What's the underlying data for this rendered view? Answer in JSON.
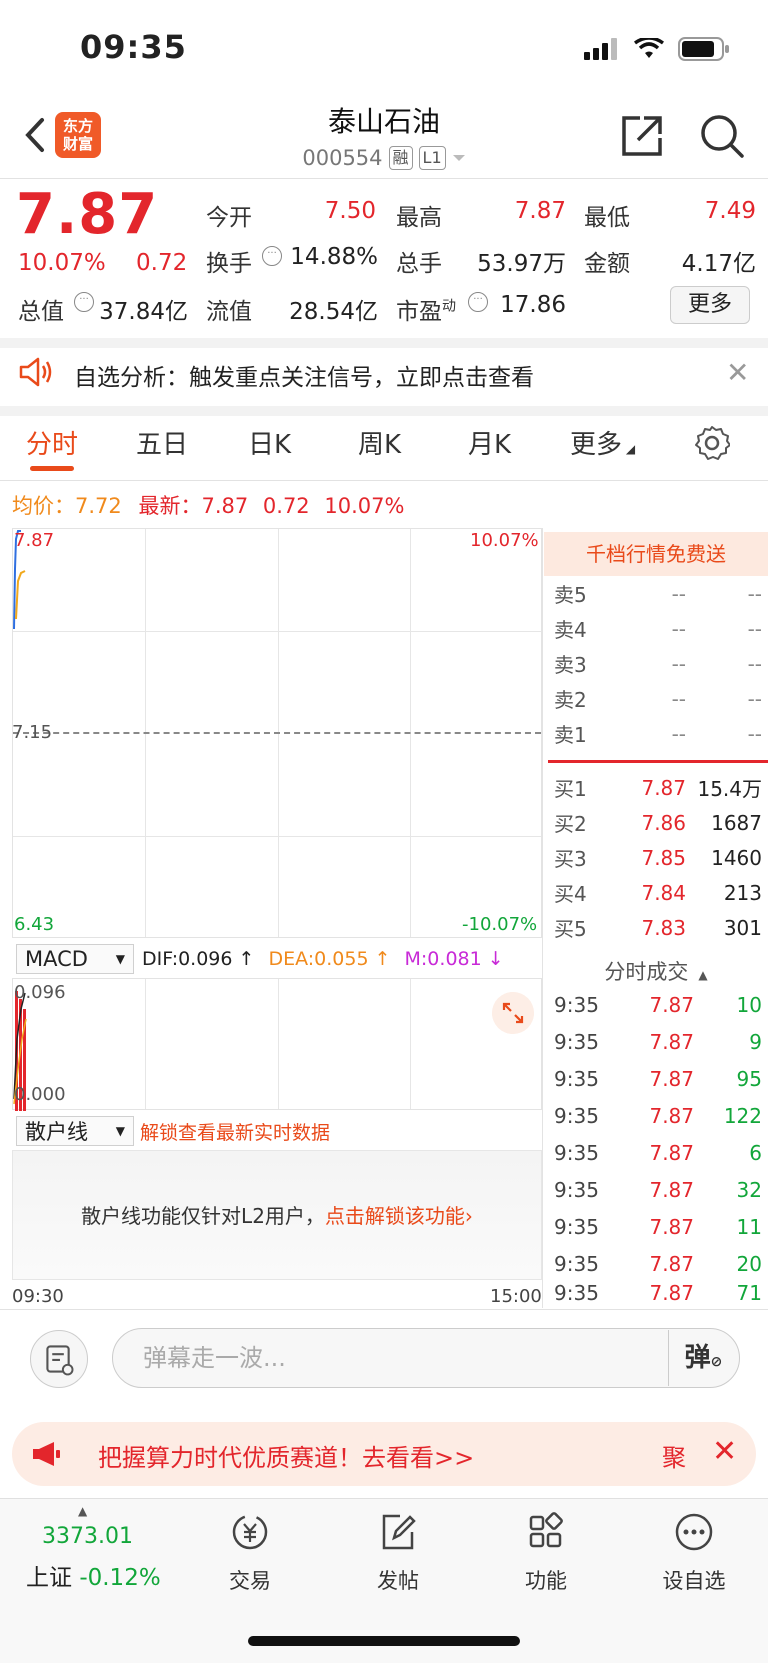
{
  "status": {
    "time": "09:35"
  },
  "header": {
    "logo_line1": "东方",
    "logo_line2": "财富",
    "stock_name": "泰山石油",
    "stock_code": "000554",
    "tag_margin": "融",
    "tag_level": "L1"
  },
  "quote": {
    "price": "7.87",
    "pct": "10.07%",
    "change": "0.72",
    "open_label": "今开",
    "open": "7.50",
    "high_label": "最高",
    "high": "7.87",
    "low_label": "最低",
    "low": "7.49",
    "turnover_label": "换手",
    "turnover": "14.88%",
    "volume_label": "总手",
    "volume": "53.97万",
    "amount_label": "金额",
    "amount": "4.17亿",
    "mcap_label": "总值",
    "mcap": "37.84亿",
    "float_label": "流值",
    "float": "28.54亿",
    "pe_label": "市盈",
    "pe_sup": "动",
    "pe": "17.86",
    "more": "更多"
  },
  "notice": {
    "text": "自选分析：触发重点关注信号，立即点击查看"
  },
  "tabs": [
    "分时",
    "五日",
    "日K",
    "周K",
    "月K",
    "更多"
  ],
  "chart_header": {
    "avg_label": "均价：",
    "avg": "7.72",
    "latest_label": "最新：",
    "latest": "7.87",
    "chg": "0.72",
    "pct": "10.07%"
  },
  "chart_data": {
    "type": "line",
    "ylim": [
      6.43,
      7.87
    ],
    "y_ticks": [
      "7.87",
      "7.15",
      "6.43"
    ],
    "pct_ticks": [
      "10.07%",
      "-10.07%"
    ],
    "x_ticks": [
      "09:30",
      "15:00"
    ],
    "baseline": 7.15
  },
  "macd": {
    "selector": "MACD",
    "dif": "DIF:0.096 ↑",
    "dea": "DEA:0.055 ↑",
    "m": "M:0.081 ↓",
    "top": "0.096",
    "bottom": "0.000"
  },
  "retail": {
    "selector": "散户线",
    "unlock_hint": "解锁查看最新实时数据",
    "desc": "散户线功能仅针对L2用户，",
    "link": "点击解锁该功能›"
  },
  "orderbook": {
    "banner": "千档行情免费送",
    "asks": [
      {
        "label": "卖5",
        "price": "--",
        "vol": "--"
      },
      {
        "label": "卖4",
        "price": "--",
        "vol": "--"
      },
      {
        "label": "卖3",
        "price": "--",
        "vol": "--"
      },
      {
        "label": "卖2",
        "price": "--",
        "vol": "--"
      },
      {
        "label": "卖1",
        "price": "--",
        "vol": "--"
      }
    ],
    "bids": [
      {
        "label": "买1",
        "price": "7.87",
        "vol": "15.4万"
      },
      {
        "label": "买2",
        "price": "7.86",
        "vol": "1687"
      },
      {
        "label": "买3",
        "price": "7.85",
        "vol": "1460"
      },
      {
        "label": "买4",
        "price": "7.84",
        "vol": "213"
      },
      {
        "label": "买5",
        "price": "7.83",
        "vol": "301"
      }
    ],
    "ticks_title": "分时成交",
    "ticks": [
      {
        "t": "9:35",
        "p": "7.87",
        "v": "10"
      },
      {
        "t": "9:35",
        "p": "7.87",
        "v": "9"
      },
      {
        "t": "9:35",
        "p": "7.87",
        "v": "95"
      },
      {
        "t": "9:35",
        "p": "7.87",
        "v": "122"
      },
      {
        "t": "9:35",
        "p": "7.87",
        "v": "6"
      },
      {
        "t": "9:35",
        "p": "7.87",
        "v": "32"
      },
      {
        "t": "9:35",
        "p": "7.87",
        "v": "11"
      },
      {
        "t": "9:35",
        "p": "7.87",
        "v": "20"
      },
      {
        "t": "9:35",
        "p": "7.87",
        "v": "71"
      }
    ]
  },
  "comment": {
    "placeholder": "弹幕走一波...",
    "danmu": "弹"
  },
  "promo": {
    "text": "把握算力时代优质赛道！去看看>>",
    "right": "聚"
  },
  "tabbar": {
    "index_value": "3373.01",
    "index_name": "上证",
    "index_pct": "-0.12%",
    "items": [
      "交易",
      "发帖",
      "功能",
      "设自选"
    ]
  },
  "colors": {
    "up": "#e3262c",
    "down": "#12a63a",
    "accent": "#e94a1a"
  }
}
